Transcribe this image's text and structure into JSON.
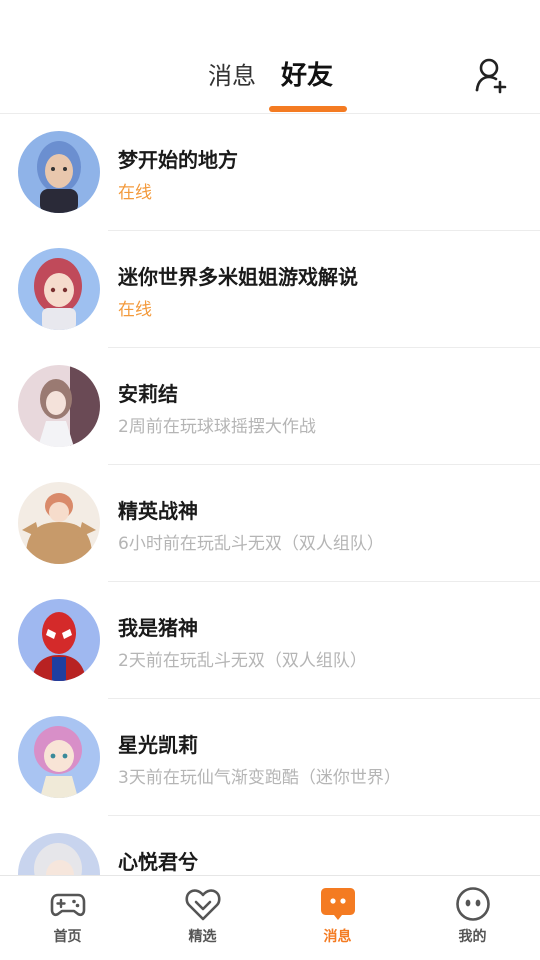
{
  "header": {
    "tabs": [
      {
        "label": "消息",
        "active": false
      },
      {
        "label": "好友",
        "active": true
      }
    ],
    "add_friend_icon": "add-user-icon"
  },
  "friends": [
    {
      "name": "梦开始的地方",
      "status": "在线",
      "online": true,
      "avatar_colors": [
        "#8fb3e8",
        "#6b8fd0"
      ]
    },
    {
      "name": "迷你世界多米姐姐游戏解说",
      "status": "在线",
      "online": true,
      "avatar_colors": [
        "#9ec0f0",
        "#c04a5a"
      ]
    },
    {
      "name": "安莉结",
      "status": "2周前在玩球球摇摆大作战",
      "online": false,
      "avatar_colors": [
        "#e8d8dc",
        "#6a4a55"
      ]
    },
    {
      "name": "精英战神",
      "status": "6小时前在玩乱斗无双（双人组队）",
      "online": false,
      "avatar_colors": [
        "#f3ece4",
        "#b88a5a"
      ]
    },
    {
      "name": "我是猪神",
      "status": "2天前在玩乱斗无双（双人组队）",
      "online": false,
      "avatar_colors": [
        "#9fb8f0",
        "#d42a2a"
      ]
    },
    {
      "name": "星光凯莉",
      "status": "3天前在玩仙气渐变跑酷（迷你世界）",
      "online": false,
      "avatar_colors": [
        "#a9c4f2",
        "#d88fc8"
      ]
    },
    {
      "name": "心悦君兮",
      "status": "",
      "online": false,
      "avatar_colors": [
        "#c8d4ee",
        "#e6e6ea"
      ]
    }
  ],
  "colors": {
    "accent": "#f47b22",
    "online": "#f39a3c",
    "offline_status": "#b5b5b5"
  },
  "bottom_nav": [
    {
      "label": "首页",
      "icon": "gamepad-icon",
      "active": false
    },
    {
      "label": "精选",
      "icon": "heart-badge-icon",
      "active": false
    },
    {
      "label": "消息",
      "icon": "chat-bubble-icon",
      "active": true
    },
    {
      "label": "我的",
      "icon": "face-icon",
      "active": false
    }
  ]
}
